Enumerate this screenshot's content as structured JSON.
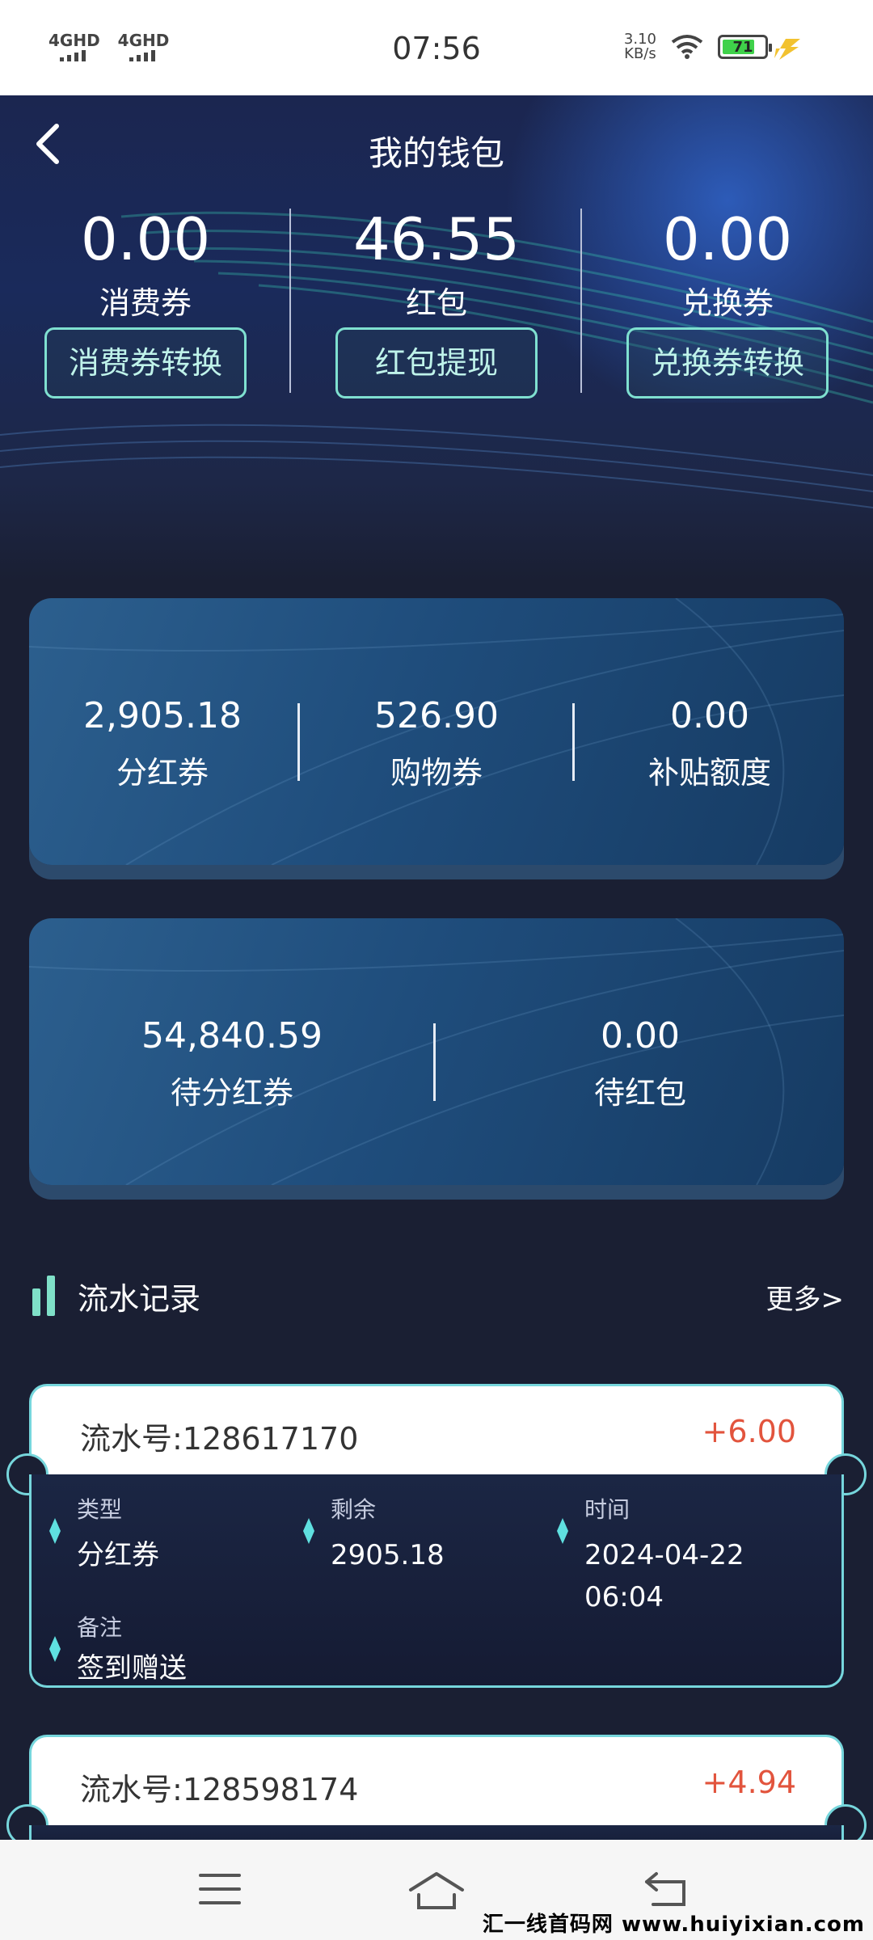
{
  "status_bar": {
    "sig1": "4GHD",
    "sig2": "4GHD",
    "time": "07:56",
    "speed_value": "3.10",
    "speed_unit": "KB/s",
    "battery": "71"
  },
  "header": {
    "title": "我的钱包"
  },
  "top_stats": [
    {
      "value": "0.00",
      "label": "消费券",
      "button": "消费券转换"
    },
    {
      "value": "46.55",
      "label": "红包",
      "button": "红包提现"
    },
    {
      "value": "0.00",
      "label": "兑换券",
      "button": "兑换券转换"
    }
  ],
  "card1": [
    {
      "value": "2,905.18",
      "label": "分红券"
    },
    {
      "value": "526.90",
      "label": "购物券"
    },
    {
      "value": "0.00",
      "label": "补贴额度"
    }
  ],
  "card2": [
    {
      "value": "54,840.59",
      "label": "待分红券"
    },
    {
      "value": "0.00",
      "label": "待红包"
    }
  ],
  "records": {
    "title": "流水记录",
    "more": "更多>",
    "items": [
      {
        "no": "流水号:128617170",
        "amount": "+6.00",
        "type_label": "类型",
        "type_value": "分红券",
        "remain_label": "剩余",
        "remain_value": "2905.18",
        "time_label": "时间",
        "time_date": "2024-04-22",
        "time_clock": "06:04",
        "note_label": "备注",
        "note_value": "签到赠送"
      },
      {
        "no": "流水号:128598174",
        "amount": "+4.94"
      }
    ]
  },
  "watermark": "汇一线首码网 www.huiyixian.com"
}
